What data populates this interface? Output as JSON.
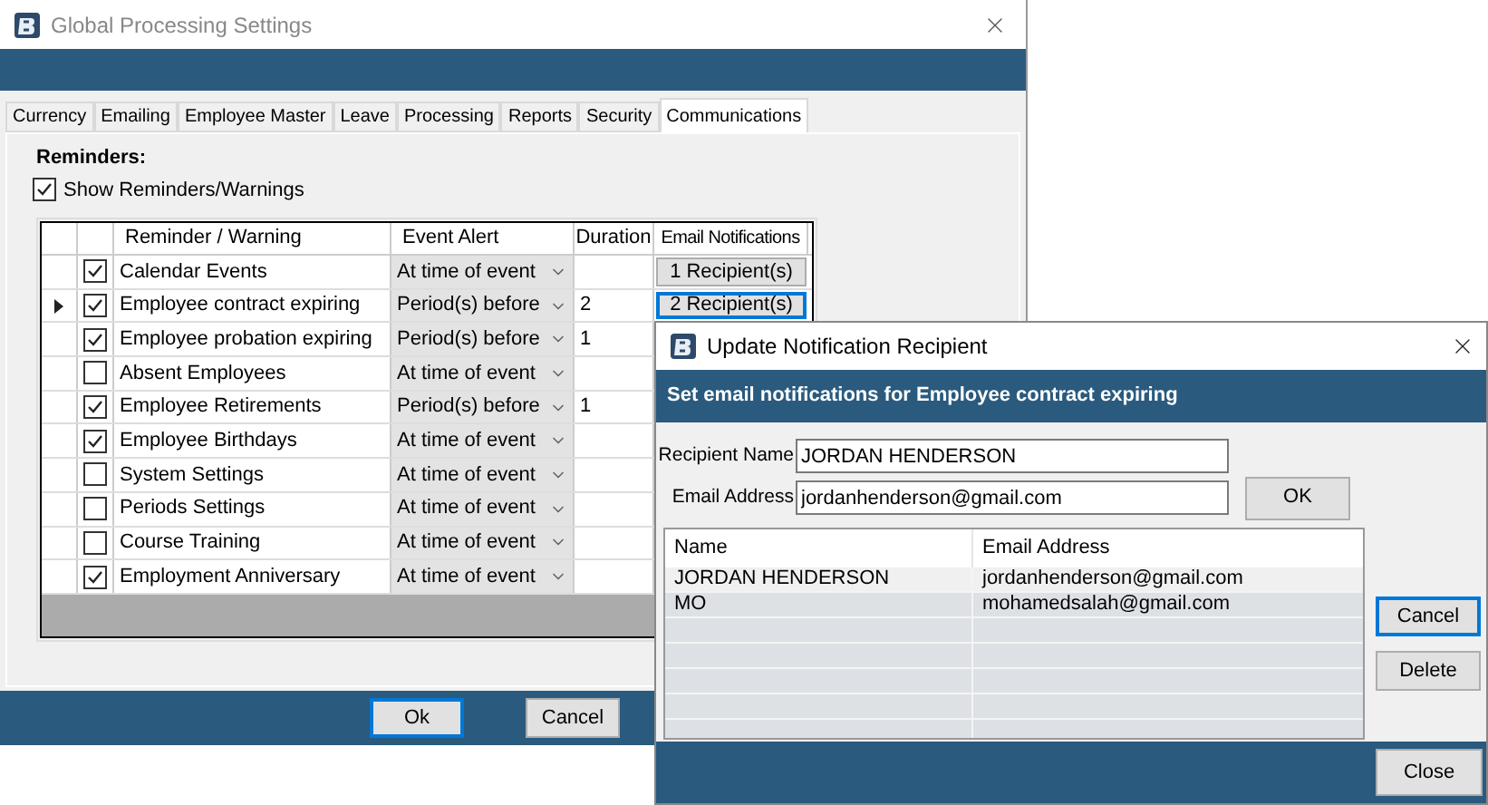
{
  "main_window": {
    "title": "Global Processing Settings",
    "tabs": [
      {
        "label": "Currency",
        "selected": false
      },
      {
        "label": "Emailing",
        "selected": false
      },
      {
        "label": "Employee Master",
        "selected": false
      },
      {
        "label": "Leave",
        "selected": false
      },
      {
        "label": "Processing",
        "selected": false
      },
      {
        "label": "Reports",
        "selected": false
      },
      {
        "label": "Security",
        "selected": false
      },
      {
        "label": "Communications",
        "selected": true
      }
    ],
    "section_label": "Reminders:",
    "show_reminders": {
      "label": "Show Reminders/Warnings",
      "checked": true
    },
    "grid": {
      "columns": [
        "Reminder / Warning",
        "Event Alert",
        "Duration",
        "Email Notifications"
      ],
      "rows": [
        {
          "current": false,
          "checked": true,
          "name": "Calendar Events",
          "event_alert": "At time of event",
          "recipients": {
            "label": "1 Recipient(s)",
            "focused": false
          }
        },
        {
          "current": true,
          "checked": true,
          "name": "Employee contract expiring",
          "event_alert": "Period(s) before",
          "duration": "2",
          "recipients": {
            "label": "2 Recipient(s)",
            "focused": true
          }
        },
        {
          "current": false,
          "checked": true,
          "name": "Employee probation expiring",
          "event_alert": "Period(s) before",
          "duration": "1"
        },
        {
          "current": false,
          "checked": false,
          "name": "Absent Employees",
          "event_alert": "At time of event"
        },
        {
          "current": false,
          "checked": true,
          "name": "Employee Retirements",
          "event_alert": "Period(s) before",
          "duration": "1"
        },
        {
          "current": false,
          "checked": true,
          "name": "Employee Birthdays",
          "event_alert": "At time of event"
        },
        {
          "current": false,
          "checked": false,
          "name": "System Settings",
          "event_alert": "At time of event"
        },
        {
          "current": false,
          "checked": false,
          "name": "Periods Settings",
          "event_alert": "At time of event"
        },
        {
          "current": false,
          "checked": false,
          "name": "Course Training",
          "event_alert": "At time of event"
        },
        {
          "current": false,
          "checked": true,
          "name": "Employment Anniversary",
          "event_alert": "At time of event"
        }
      ]
    },
    "buttons": [
      {
        "label": "Ok",
        "focused": true
      },
      {
        "label": "Cancel",
        "focused": false
      }
    ]
  },
  "dialog": {
    "title": "Update Notification Recipient",
    "heading": "Set email notifications for Employee contract expiring",
    "fields": [
      {
        "label": "Recipient Name",
        "value": "JORDAN HENDERSON"
      },
      {
        "label": "Email Address",
        "value": "jordanhenderson@gmail.com"
      }
    ],
    "ok_button": "OK",
    "list": {
      "columns": [
        "Name",
        "Email Address"
      ],
      "rows": [
        {
          "name": "JORDAN HENDERSON",
          "email": "jordanhenderson@gmail.com",
          "selected": true
        },
        {
          "name": "MO",
          "email": "mohamedsalah@gmail.com",
          "selected": false
        }
      ]
    },
    "side_buttons": [
      {
        "label": "Cancel",
        "focused": true
      },
      {
        "label": "Delete",
        "focused": false
      }
    ],
    "footer_button": "Close"
  }
}
